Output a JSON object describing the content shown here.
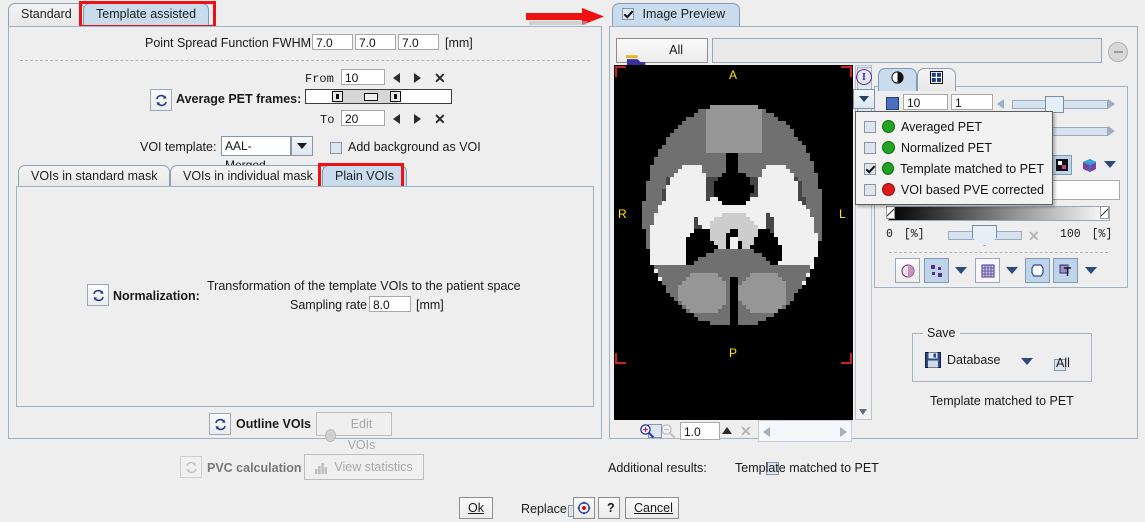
{
  "left": {
    "tabs": [
      {
        "label": "Standard",
        "selected": false,
        "highlight": false
      },
      {
        "label": "Template assisted",
        "selected": true,
        "highlight": true
      }
    ],
    "psf": {
      "label": "Point Spread Function FWHM",
      "x": "7.0",
      "y": "7.0",
      "z": "7.0",
      "unit": "[mm]"
    },
    "frames": {
      "label": "Average PET frames:",
      "from_label": "From",
      "from_value": "10",
      "to_label": "To",
      "to_value": "20"
    },
    "voi_template": {
      "label": "VOI template:",
      "value": "AAL-Merged"
    },
    "add_background": {
      "label": "Add background as VOI",
      "checked": false
    },
    "inner_tabs": [
      {
        "label": "VOIs in standard mask",
        "selected": false,
        "highlight": false
      },
      {
        "label": "VOIs in individual mask",
        "selected": false,
        "highlight": false
      },
      {
        "label": "Plain VOIs",
        "selected": true,
        "highlight": true
      }
    ],
    "normalization": {
      "label": "Normalization:",
      "description": "Transformation of the template VOIs to the patient space",
      "sampling_label": "Sampling rate",
      "sampling_value": "8.0",
      "sampling_unit": "[mm]"
    },
    "outline_vois": {
      "label": "Outline VOIs"
    },
    "edit_vois": {
      "label": "Edit VOIs",
      "enabled": false
    },
    "pvc_calculation": {
      "label": "PVC calculation",
      "enabled": false
    },
    "view_statistics": {
      "label": "View statistics",
      "enabled": false
    }
  },
  "footer": {
    "ok": "Ok",
    "replace": {
      "label": "Replace",
      "checked": false
    },
    "help": "?",
    "cancel": "Cancel"
  },
  "right": {
    "tab": {
      "label": "Image Preview",
      "checked": true
    },
    "all_steps": {
      "label": "All steps"
    },
    "step_field": {
      "value": "",
      "placeholder": ""
    },
    "image": {
      "orientation": {
        "top": "A",
        "bottom": "P",
        "left": "R",
        "right": "L"
      }
    },
    "layer_menu": {
      "items": [
        {
          "label": "Averaged PET",
          "checked": false,
          "color": "#22a322"
        },
        {
          "label": "Normalized PET",
          "checked": false,
          "color": "#22a322"
        },
        {
          "label": "Template matched to PET",
          "checked": true,
          "color": "#22a322"
        },
        {
          "label": "VOI based PVE corrected",
          "checked": false,
          "color": "#e01b1b"
        }
      ]
    },
    "slice_controls": {
      "index": "10",
      "increment": "1"
    },
    "colorbar": {
      "min": "0",
      "min_unit": "[%]",
      "max": "100",
      "max_unit": "[%]"
    },
    "save_group": {
      "title": "Save",
      "target": "Database",
      "all": {
        "label": "All",
        "checked": false
      }
    },
    "status_text": "Template matched to PET",
    "zoom_bar": {
      "value": "1.0",
      "checked": false
    },
    "additional_results": {
      "label": "Additional results:",
      "item": {
        "label": "Template matched to PET",
        "checked": false
      }
    }
  },
  "annotation": {
    "arrow": "red-right-arrow"
  },
  "colors": {
    "tab_selected": "#c9dcee",
    "highlight": "#ee1111",
    "orientation_text": "#ffe400"
  }
}
